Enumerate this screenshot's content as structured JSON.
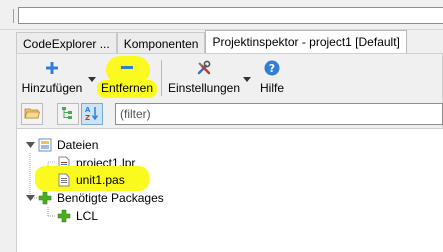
{
  "tabs": [
    {
      "label": "CodeExplorer ...",
      "active": false
    },
    {
      "label": "Komponenten",
      "active": false
    },
    {
      "label": "Projektinspektor - project1 [Default]",
      "active": true
    }
  ],
  "toolbar": {
    "add_label": "Hinzufügen",
    "remove_label": "Entfernen",
    "settings_label": "Einstellungen",
    "help_label": "Hilfe",
    "add_icon": "plus-icon",
    "remove_icon": "minus-icon",
    "settings_icon": "tools-icon",
    "help_icon": "help-icon"
  },
  "filter": {
    "placeholder": "(filter)"
  },
  "tree": {
    "files_label": "Dateien",
    "files_children": [
      "project1.lpr",
      "unit1.pas"
    ],
    "packages_label": "Benötigte Packages",
    "packages_children": [
      "LCL"
    ]
  },
  "colors": {
    "highlight": "#fafa1e",
    "accent_blue": "#2f7fd3",
    "package_green": "#4caf1f"
  }
}
